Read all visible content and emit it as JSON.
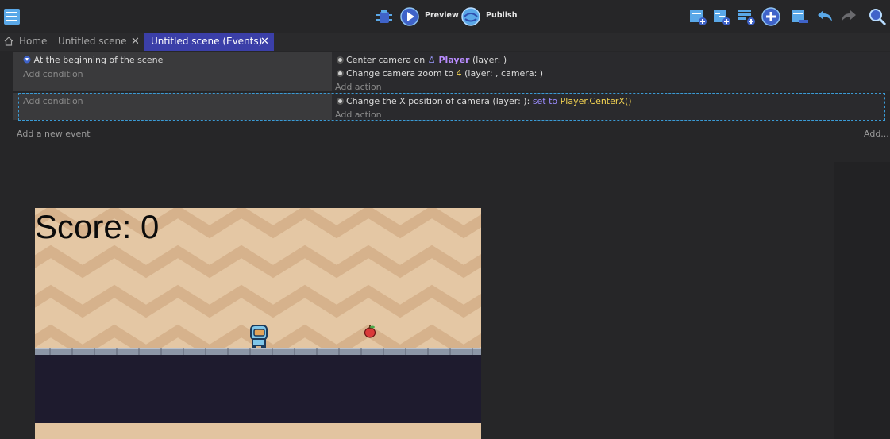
{
  "toolbar": {
    "preview_label": "Preview",
    "publish_label": "Publish"
  },
  "tabs": [
    {
      "label": "Home"
    },
    {
      "label": "Untitled scene"
    },
    {
      "label": "Untitled scene (Events)"
    }
  ],
  "events": {
    "event1": {
      "condition": "At the beginning of the scene",
      "add_condition": "Add condition",
      "action1_prefix": "Center camera on",
      "action1_object": "Player",
      "action1_suffix": "(layer: )",
      "action2_prefix": "Change camera zoom to",
      "action2_value": "4",
      "action2_suffix": "(layer: , camera: )",
      "add_action": "Add action"
    },
    "event2": {
      "add_condition": "Add condition",
      "action1_prefix": "Change the X position of camera",
      "action1_mid": "(layer: ):",
      "action1_op": "set to",
      "action1_value": "Player.CenterX()",
      "add_action": "Add action"
    },
    "add_new_event": "Add a new event",
    "add_menu": "Add..."
  },
  "game": {
    "score_text": "Score: 0"
  },
  "colors": {
    "accent_tab": "#3b3fa8",
    "object_name": "#b98cff",
    "number_value": "#f3d352",
    "selection_outline": "#3a9bd6"
  }
}
